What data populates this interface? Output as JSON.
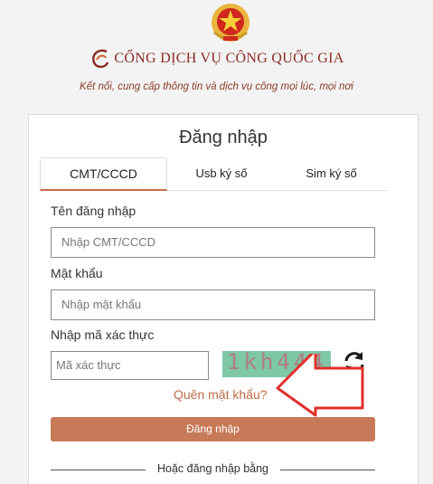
{
  "header": {
    "title": "CỔNG DỊCH VỤ CÔNG QUỐC GIA",
    "subtitle": "Kết nối, cung cấp thông tin và dịch vụ công mọi lúc, mọi nơi"
  },
  "login": {
    "title": "Đăng nhập",
    "tabs": [
      {
        "label": "CMT/CCCD",
        "active": true
      },
      {
        "label": "Usb ký số",
        "active": false
      },
      {
        "label": "Sim ký số",
        "active": false
      }
    ],
    "username_label": "Tên đăng nhập",
    "username_placeholder": "Nhập CMT/CCCD",
    "password_label": "Mật khẩu",
    "password_placeholder": "Nhập mật khẩu",
    "captcha_label": "Nhập mã xác thực",
    "captcha_placeholder": "Mã xác thực",
    "captcha_code": "1kh444",
    "forgot_label": "Quên mật khẩu?",
    "submit_label": "Đăng nhập",
    "alt_login_label": "Hoặc đăng nhập bằng"
  },
  "colors": {
    "brand": "#8a2c23",
    "accent": "#c77a58",
    "link": "#c06a48",
    "arrow": "#e0302a",
    "captcha_bg": "#7ec7a7"
  },
  "icons": {
    "emblem": "national-emblem-icon",
    "brand_swirl": "brand-swirl-icon",
    "refresh": "refresh-icon",
    "annotation_arrow": "red-arrow-icon"
  }
}
